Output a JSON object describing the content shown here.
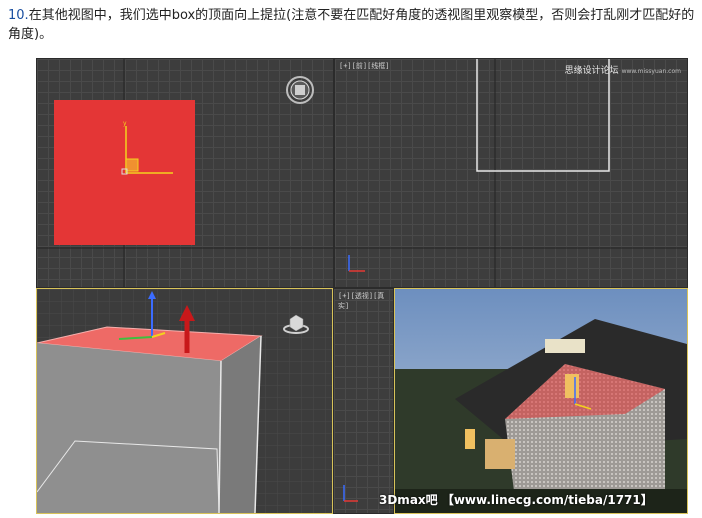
{
  "caption": {
    "number": "10.",
    "text": "在其他视图中，我们选中box的顶面向上提拉(注意不要在匹配好角度的透视图里观察模型，否则会打乱刚才匹配好的角度)。"
  },
  "viewports": {
    "top_left": {
      "label": ""
    },
    "top_right": {
      "label": "[+][前][线框]"
    },
    "bottom_left": {
      "label": ""
    },
    "bottom_right_small": {
      "label": "[+][透视][真实]"
    }
  },
  "watermark": {
    "site": "思缘设计论坛",
    "url": "www.missyuan.com",
    "bottom": "3Dmax吧 【www.linecg.com/tieba/1771】"
  },
  "colors": {
    "selection_red": "#e43636",
    "viewport_bg": "#3d3d3d",
    "active_border": "#d8c35a",
    "gizmo_yellow": "#f3d21e"
  }
}
